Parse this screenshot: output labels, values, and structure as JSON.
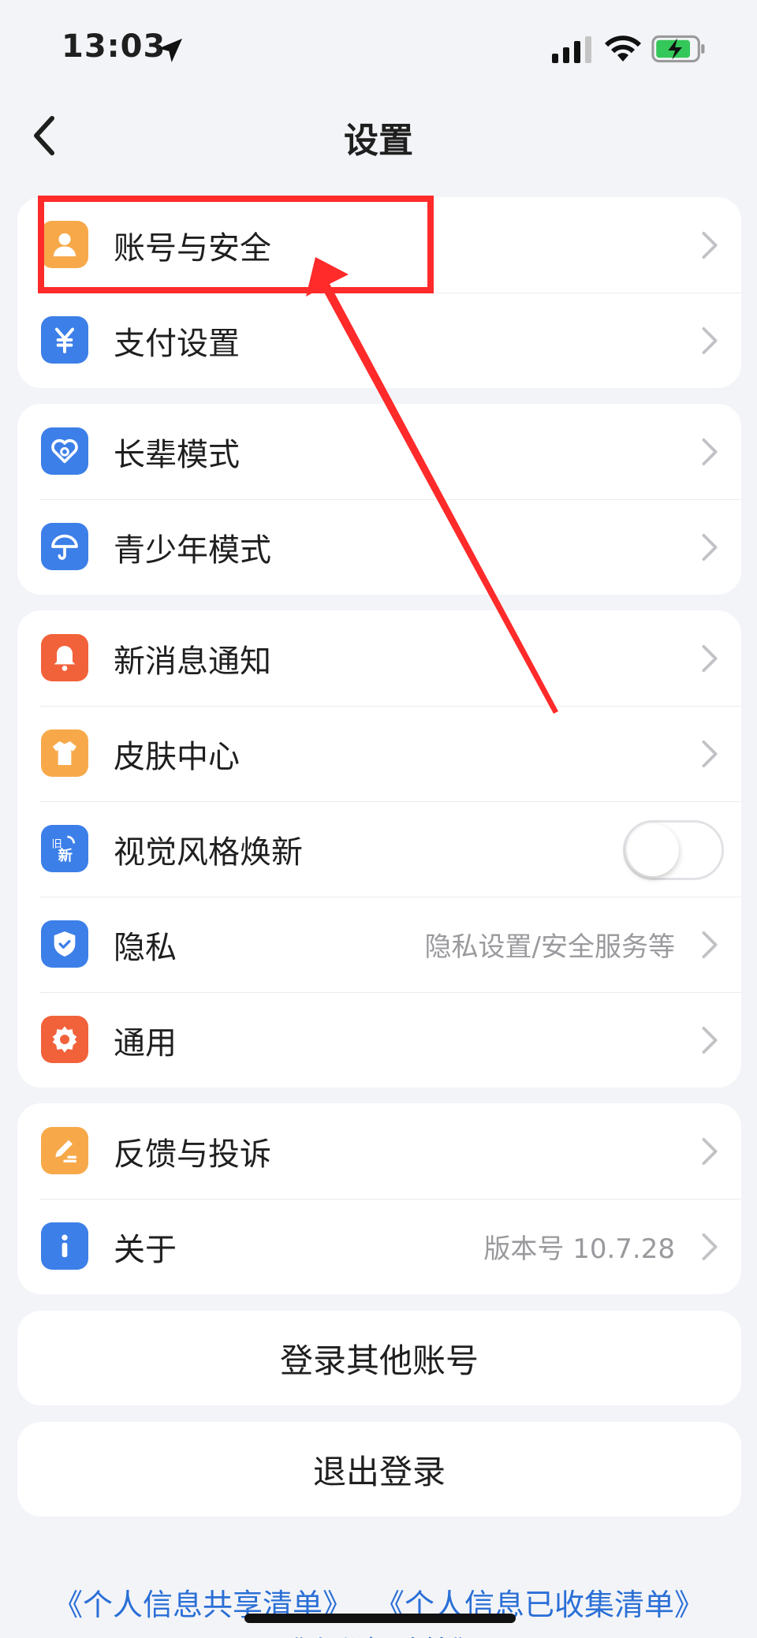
{
  "status_bar": {
    "time": "13:03",
    "icons": [
      "location-arrow-icon",
      "signal-icon",
      "wifi-icon",
      "battery-charging-icon"
    ]
  },
  "nav": {
    "title": "设置",
    "back_icon": "chevron-left-icon"
  },
  "groups": [
    {
      "rows": [
        {
          "name": "account-security",
          "label": "账号与安全",
          "icon": "user-icon",
          "color": "#f7a94a"
        },
        {
          "name": "payment-settings",
          "label": "支付设置",
          "icon": "yuan-icon",
          "color": "#3d7fe8"
        }
      ]
    },
    {
      "rows": [
        {
          "name": "elder-mode",
          "label": "长辈模式",
          "icon": "heart-icon",
          "color": "#3d7fe8"
        },
        {
          "name": "youth-mode",
          "label": "青少年模式",
          "icon": "umbrella-icon",
          "color": "#3d7fe8"
        }
      ]
    },
    {
      "rows": [
        {
          "name": "notifications",
          "label": "新消息通知",
          "icon": "bell-icon",
          "color": "#f2623a"
        },
        {
          "name": "skin-center",
          "label": "皮肤中心",
          "icon": "shirt-icon",
          "color": "#f7a94a"
        },
        {
          "name": "visual-style",
          "label": "视觉风格焕新",
          "icon": "new-style-icon",
          "color": "#3d7fe8",
          "toggle": false
        },
        {
          "name": "privacy",
          "label": "隐私",
          "value": "隐私设置/安全服务等",
          "icon": "shield-icon",
          "color": "#3d7fe8"
        },
        {
          "name": "general",
          "label": "通用",
          "icon": "gear-icon",
          "color": "#f2623a"
        }
      ]
    },
    {
      "rows": [
        {
          "name": "feedback",
          "label": "反馈与投诉",
          "icon": "edit-icon",
          "color": "#f7a94a"
        },
        {
          "name": "about",
          "label": "关于",
          "value": "版本号 10.7.28",
          "icon": "info-icon",
          "color": "#3d7fe8"
        }
      ]
    }
  ],
  "buttons": {
    "switch_account": "登录其他账号",
    "logout": "退出登录"
  },
  "footer": {
    "link1": "《个人信息共享清单》",
    "link2": "《个人信息已收集清单》",
    "link3": "《隐私权政策》"
  },
  "annotation": {
    "color": "#ff2a2a"
  }
}
